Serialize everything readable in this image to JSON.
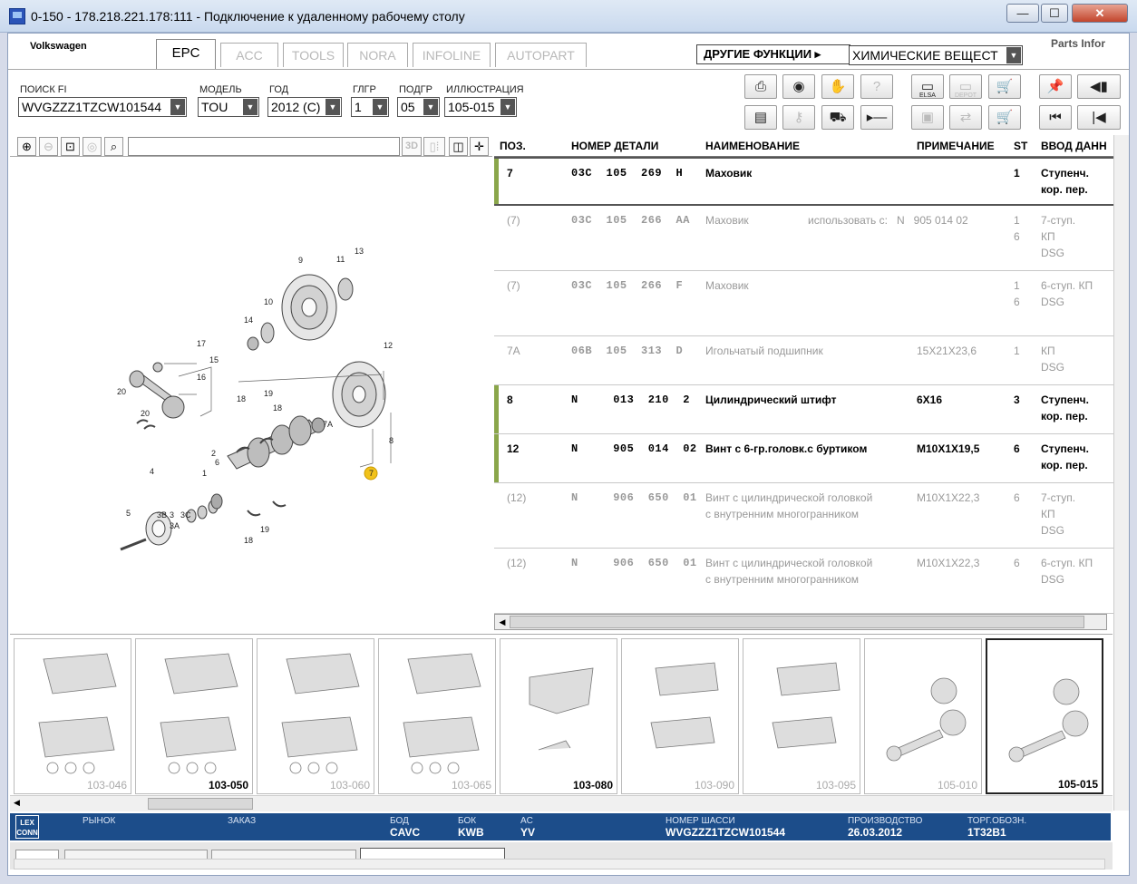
{
  "window": {
    "title": "0-150 - 178.218.221.178:111 - Подключение к удаленному рабочему столу",
    "minimize": "—",
    "maximize": "☐",
    "close": "✕"
  },
  "header": {
    "brand": "Volkswagen",
    "tabs": [
      "EPC",
      "ACC",
      "TOOLS",
      "NORA",
      "INFOLINE",
      "AUTOPART"
    ],
    "active_tab": "EPC",
    "other_functions": "ДРУГИЕ ФУНКЦИИ ▸",
    "chemicals_select": "ХИМИЧЕСКИЕ ВЕЩЕСТ",
    "logo_text": "Parts Infor"
  },
  "filters": {
    "search_fi_label": "ПОИСК FI",
    "search_fi_value": "WVGZZZ1TZCW101544",
    "model_label": "МОДЕЛЬ",
    "model_value": "TOU",
    "year_label": "ГОД",
    "year_value": "2012 (C)",
    "main_group_label": "ГЛГР",
    "main_group_value": "1",
    "sub_group_label": "ПОДГР",
    "sub_group_value": "05",
    "illustration_label": "ИЛЛЮСТРАЦИЯ",
    "illustration_value": "105-015"
  },
  "toolbar_icons": {
    "elsa_label": "ELSA",
    "depot_label": "DEPOT"
  },
  "illustration_toolbar": {
    "3d_label": "3D"
  },
  "diagram": {
    "callouts": [
      "13",
      "9",
      "11",
      "10",
      "14",
      "17",
      "15",
      "16",
      "12",
      "20",
      "20",
      "18",
      "19",
      "18",
      "7A",
      "8",
      "7",
      "4",
      "2",
      "3B",
      "3",
      "3C",
      "3A",
      "5",
      "6",
      "18",
      "19",
      "1"
    ]
  },
  "parts_table": {
    "columns": [
      "ПОЗ.",
      "НОМЕР ДЕТАЛИ",
      "НАИМЕНОВАНИЕ",
      "ПРИМЕЧАНИЕ",
      "ST",
      "ВВОД ДАНН"
    ],
    "rows": [
      {
        "pos": "7",
        "part": "03C  105  269  H",
        "name": "Маховик",
        "note": "",
        "st": "1",
        "input": "Ступенч.\nкор. пер.",
        "state": "active"
      },
      {
        "pos": "(7)",
        "part": "03C  105  266  AA",
        "name": "Маховик",
        "note": "использовать с:   N   905 014 02",
        "st": "1\n6",
        "input": "7-ступ.\nКП\nDSG",
        "state": "inactive"
      },
      {
        "pos": "(7)",
        "part": "03C  105  266  F",
        "name": "Маховик",
        "note": "",
        "st": "1\n6",
        "input": "6-ступ. КП\nDSG",
        "state": "inactive"
      },
      {
        "pos": "7A",
        "part": "06B  105  313  D",
        "name": "Игольчатый подшипник",
        "note": "15X21X23,6",
        "st": "1",
        "input": "КП\nDSG",
        "state": "inactive"
      },
      {
        "pos": "8",
        "part": "N     013  210  2",
        "name": "Цилиндрический штифт",
        "note": "6X16",
        "st": "3",
        "input": "Ступенч.\nкор. пер.",
        "state": "active"
      },
      {
        "pos": "12",
        "part": "N     905  014  02",
        "name": "Винт с 6-гр.головк.с буртиком",
        "note": "M10X1X19,5",
        "st": "6",
        "input": "Ступенч.\nкор. пер.",
        "state": "active"
      },
      {
        "pos": "(12)",
        "part": "N     906  650  01",
        "name": "Винт с цилиндрической головкой\nс внутренним многогранником",
        "note": "M10X1X22,3",
        "st": "6",
        "input": "7-ступ.\nКП\nDSG",
        "state": "inactive"
      },
      {
        "pos": "(12)",
        "part": "N     906  650  01",
        "name": "Винт с цилиндрической головкой\nс внутренним многогранником",
        "note": "M10X1X22,3",
        "st": "6",
        "input": "6-ступ. КП\nDSG",
        "state": "inactive"
      }
    ]
  },
  "thumbnails": [
    {
      "label": "103-046",
      "bold": false
    },
    {
      "label": "103-050",
      "bold": true
    },
    {
      "label": "103-060",
      "bold": false
    },
    {
      "label": "103-065",
      "bold": false
    },
    {
      "label": "103-080",
      "bold": true
    },
    {
      "label": "103-090",
      "bold": false
    },
    {
      "label": "103-095",
      "bold": false
    },
    {
      "label": "105-010",
      "bold": false
    },
    {
      "label": "105-015",
      "bold": true,
      "selected": true
    }
  ],
  "status": {
    "logo": "LEX\nCONN",
    "market_label": "РЫНОК",
    "order_label": "ЗАКАЗ",
    "bod_label": "БОД",
    "bod_value": "CAVC",
    "bok_label": "БОК",
    "bok_value": "KWB",
    "ac_label": "AC",
    "ac_value": "YV",
    "chassis_label": "НОМЕР ШАССИ",
    "chassis_value": "WVGZZZ1TZCW101544",
    "production_label": "ПРОИЗВОДСТВО",
    "production_value": "26.03.2012",
    "trade_label": "ТОРГ.ОБОЗН.",
    "trade_value": "1T32B1"
  }
}
